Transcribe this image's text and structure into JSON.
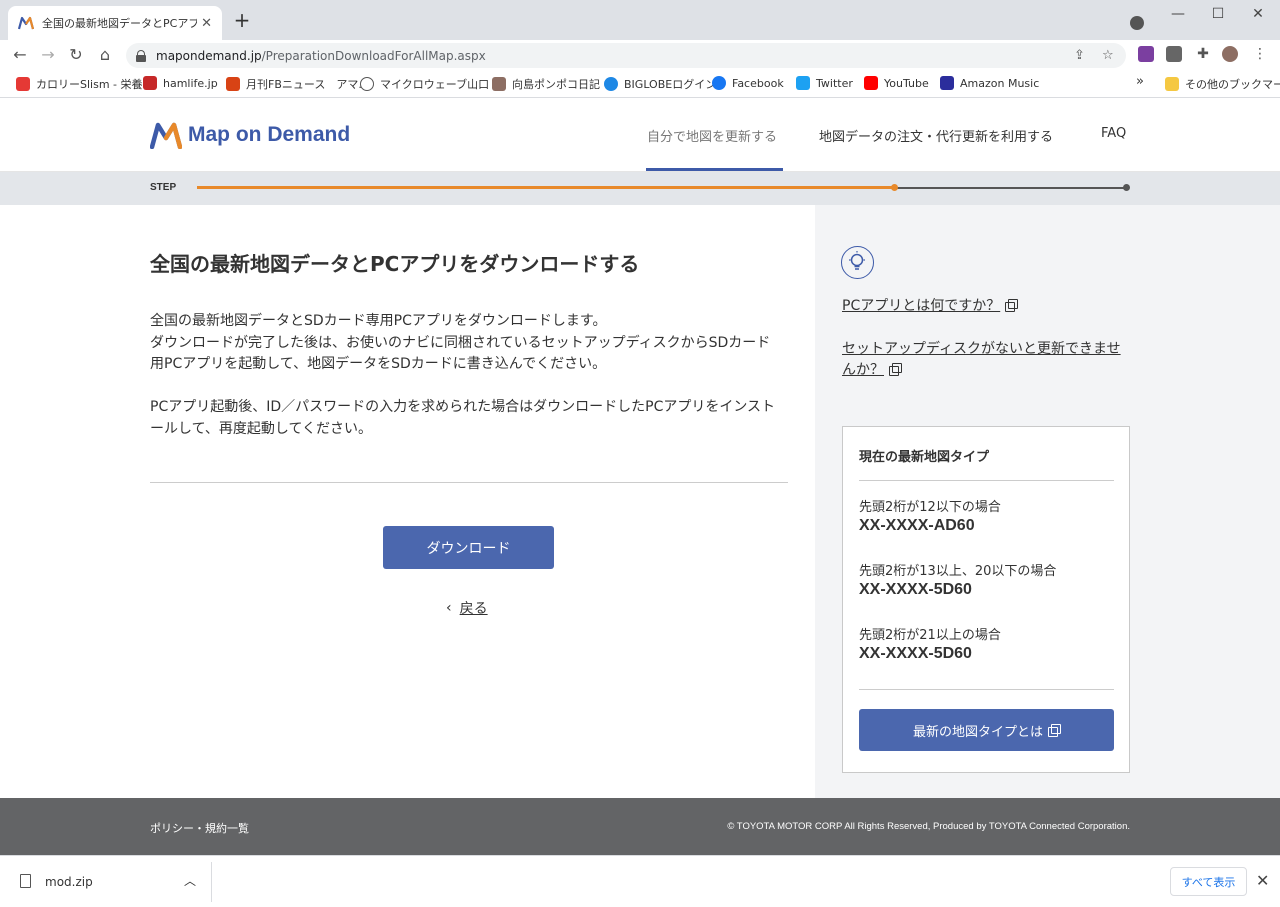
{
  "browser": {
    "tab_title": "全国の最新地図データとPCアプリを",
    "url_host": "mapondemand.jp",
    "url_path": "/PreparationDownloadForAllMap.aspx"
  },
  "bookmarks": [
    {
      "label": "カロリーSlism - 栄養...",
      "color": "#e53935",
      "icon": "slism-icon"
    },
    {
      "label": "hamlife.jp",
      "color": "#c62828",
      "icon": "hamlife-icon"
    },
    {
      "label": "月刊FBニュース　アマ...",
      "color": "#d84315",
      "icon": "fb-news-icon"
    },
    {
      "label": "マイクロウェーブ山口 -...",
      "color": "#555555",
      "icon": "microwave-icon"
    },
    {
      "label": "向島ポンポコ日記",
      "color": "#8d6e63",
      "icon": "pompoko-icon"
    },
    {
      "label": "BIGLOBEログイン",
      "color": "#1e88e5",
      "icon": "biglobe-icon"
    },
    {
      "label": "Facebook",
      "color": "#1877f2",
      "icon": "facebook-icon"
    },
    {
      "label": "Twitter",
      "color": "#1da1f2",
      "icon": "twitter-icon"
    },
    {
      "label": "YouTube",
      "color": "#ff0000",
      "icon": "youtube-icon"
    },
    {
      "label": "Amazon Music",
      "color": "#2b2d9c",
      "icon": "amazon-music-icon"
    }
  ],
  "bookmarks_other": "その他のブックマーク",
  "header": {
    "logo_text": "Map on Demand",
    "nav": [
      "自分で地図を更新する",
      "地図データの注文・代行更新を利用する",
      "FAQ"
    ]
  },
  "step": {
    "label": "STEP",
    "progress": 0.75,
    "colors": {
      "done": "#e8892a",
      "todo": "#555555"
    }
  },
  "main": {
    "title": "全国の最新地図データとPCアプリをダウンロードする",
    "para1_lines": [
      "全国の最新地図データとSDカード専用PCアプリをダウンロードします。",
      "ダウンロードが完了した後は、お使いのナビに同梱されているセットアップディスクからSDカード",
      "用PCアプリを起動して、地図データをSDカードに書き込んでください。"
    ],
    "para2_lines": [
      "PCアプリ起動後、ID／パスワードの入力を求められた場合はダウンロードしたPCアプリをインスト",
      "ールして、再度起動してください。"
    ],
    "download_label": "ダウンロード",
    "back_label": "戻る"
  },
  "side": {
    "link1": "PCアプリとは何ですか？",
    "link2_line1": "セットアップディスクがないと更新できませ",
    "link2_line2": "んか？",
    "card": {
      "title": "現在の最新地図タイプ",
      "items": [
        {
          "cond": "先頭2桁が12以下の場合",
          "code": "XX-XXXX-AD60"
        },
        {
          "cond": "先頭2桁が13以上、20以下の場合",
          "code": "XX-XXXX-5D60"
        },
        {
          "cond": "先頭2桁が21以上の場合",
          "code": "XX-XXXX-5D60"
        }
      ],
      "button": "最新の地図タイプとは"
    }
  },
  "footer": {
    "left": "ポリシー・規約一覧",
    "right": "© TOYOTA MOTOR CORP All Rights Reserved, Produced by TOYOTA Connected Corporation."
  },
  "download_bar": {
    "file": "mod.zip",
    "show_all": "すべて表示"
  },
  "colors": {
    "brand": "#3d5aa8",
    "button": "#4b67ae",
    "footer": "#636466"
  }
}
